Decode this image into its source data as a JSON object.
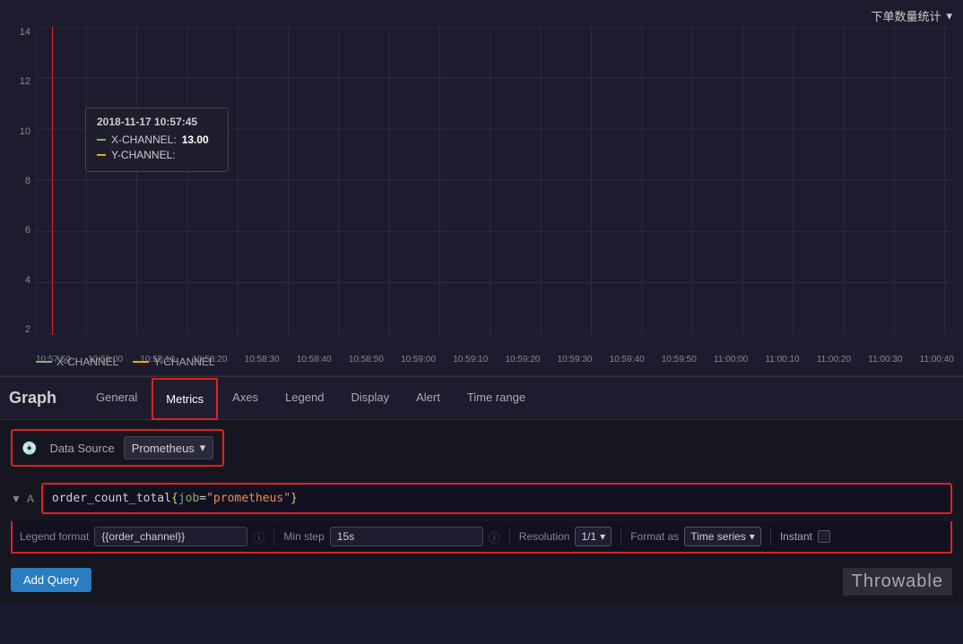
{
  "chart": {
    "title": "下单数量统计",
    "y_labels": [
      "14",
      "12",
      "10",
      "8",
      "6",
      "4",
      "2"
    ],
    "x_labels": [
      "10:57:50",
      "10:58:00",
      "10:58:10",
      "10:58:20",
      "10:58:30",
      "10:58:40",
      "10:58:50",
      "10:59:00",
      "10:59:10",
      "10:59:20",
      "10:59:30",
      "10:59:40",
      "10:59:50",
      "11:00:00",
      "11:00:10",
      "11:00:20",
      "11:00:30",
      "11:00:40"
    ],
    "tooltip": {
      "date": "2018-11-17 10:57:45",
      "x_channel_label": "X-CHANNEL:",
      "x_channel_value": "13.00",
      "y_channel_label": "Y-CHANNEL:"
    },
    "legend": {
      "x_channel": "X-CHANNEL",
      "y_channel": "Y-CHANNEL"
    }
  },
  "graph": {
    "title": "Graph",
    "tabs": [
      {
        "label": "General",
        "active": false
      },
      {
        "label": "Metrics",
        "active": true
      },
      {
        "label": "Axes",
        "active": false
      },
      {
        "label": "Legend",
        "active": false
      },
      {
        "label": "Display",
        "active": false
      },
      {
        "label": "Alert",
        "active": false
      },
      {
        "label": "Time range",
        "active": false
      }
    ]
  },
  "query": {
    "datasource_label": "Data Source",
    "datasource_value": "Prometheus",
    "query_text_plain": "order_count_total{job=\"prometheus\"}",
    "query_keyword": "order_count_total",
    "query_braces_open": "{",
    "query_key": "job",
    "query_eq": "=",
    "query_value": "\"prometheus\"",
    "query_braces_close": "}",
    "options": {
      "legend_format_label": "Legend format",
      "legend_format_value": "{{order_channel}}",
      "min_step_label": "Min step",
      "min_step_value": "15s",
      "resolution_label": "Resolution",
      "resolution_value": "1/1",
      "format_as_label": "Format as",
      "format_as_value": "Time series",
      "instant_label": "Instant"
    },
    "add_query_label": "Add Query"
  },
  "watermark": "Throwable"
}
